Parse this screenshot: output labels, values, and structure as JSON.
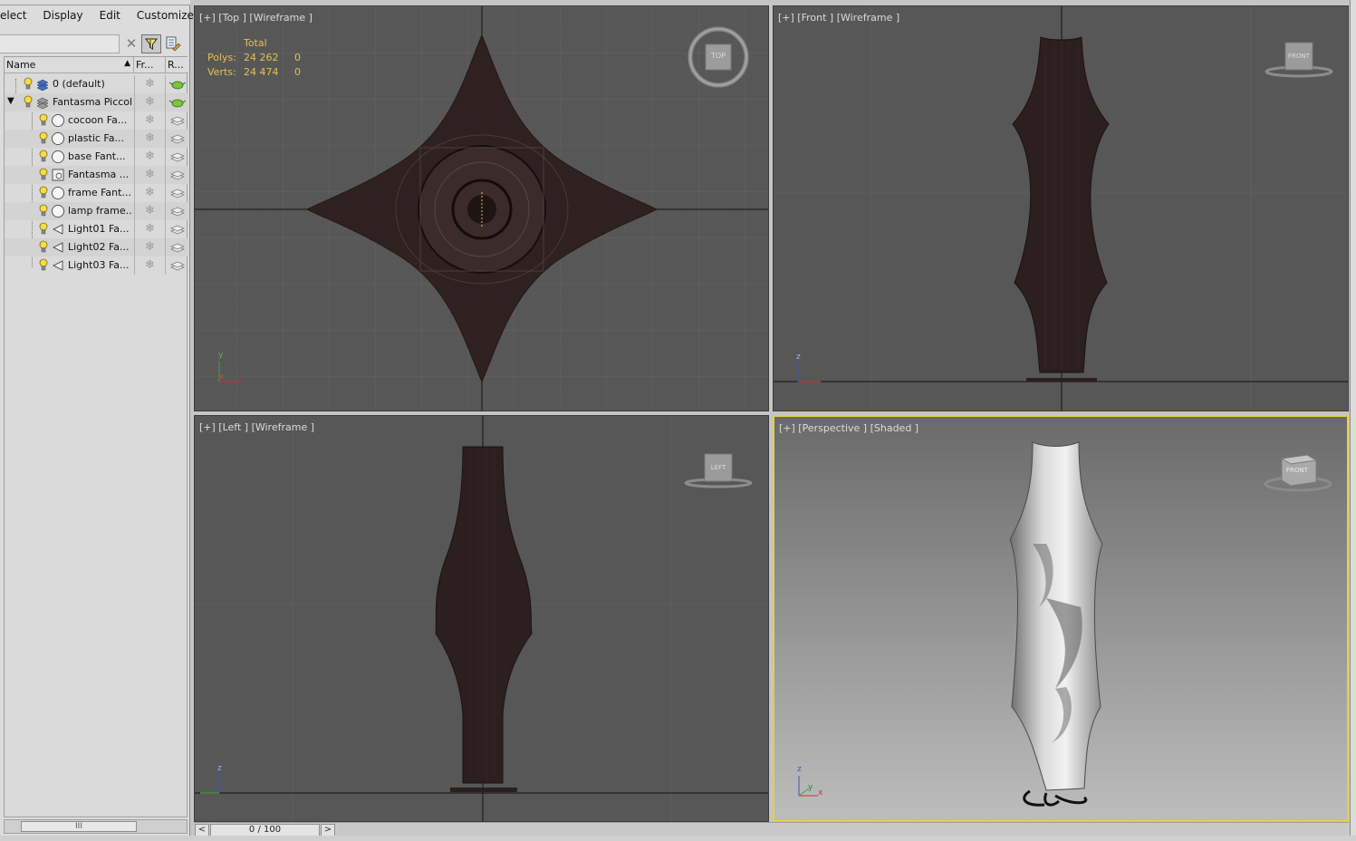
{
  "menu": [
    "elect",
    "Display",
    "Edit",
    "Customize"
  ],
  "scene_explorer": {
    "filter_value": "",
    "columns": {
      "name": "Name",
      "freeze": "Fr...",
      "render": "R..."
    },
    "rows": [
      {
        "label": "0 (default)",
        "type": "layer",
        "level": 0,
        "expander": ""
      },
      {
        "label": "Fantasma Piccolo",
        "type": "layer",
        "level": 0,
        "expander": "▼"
      },
      {
        "label": "cocoon  Fa...",
        "type": "geometry",
        "level": 1,
        "expander": ""
      },
      {
        "label": "plastic  Fa...",
        "type": "geometry",
        "level": 1,
        "expander": ""
      },
      {
        "label": "base  Fant...",
        "type": "geometry",
        "level": 1,
        "expander": ""
      },
      {
        "label": "Fantasma ...",
        "type": "group",
        "level": 1,
        "expander": ""
      },
      {
        "label": "frame  Fant...",
        "type": "geometry",
        "level": 1,
        "expander": ""
      },
      {
        "label": "lamp frame...",
        "type": "geometry",
        "level": 1,
        "expander": ""
      },
      {
        "label": "Light01  Fa...",
        "type": "light",
        "level": 1,
        "expander": ""
      },
      {
        "label": "Light02  Fa...",
        "type": "light",
        "level": 1,
        "expander": ""
      },
      {
        "label": "Light03  Fa...",
        "type": "light",
        "level": 1,
        "expander": ""
      }
    ],
    "scroll_grip": "III"
  },
  "viewports": {
    "top": {
      "label": "[+] [Top ] [Wireframe ]",
      "cube_label": "TOP"
    },
    "front": {
      "label": "[+] [Front ] [Wireframe ]",
      "cube_label": "FRONT"
    },
    "left": {
      "label": "[+] [Left ] [Wireframe ]",
      "cube_label": "LEFT"
    },
    "perspective": {
      "label": "[+] [Perspective ] [Shaded ]",
      "cube_label": "FRONT"
    }
  },
  "stats": {
    "header": "Total",
    "polys_label": "Polys:",
    "polys_total": "24 262",
    "polys_sel": "0",
    "verts_label": "Verts:",
    "verts_total": "24 474",
    "verts_sel": "0"
  },
  "axes": {
    "x": "x",
    "y": "y",
    "z": "z"
  },
  "timeline": {
    "frame": "0 / 100",
    "prev": "<",
    "next": ">"
  },
  "colors": {
    "active_viewport_border": "#e4d23a",
    "stats_text": "#e3c14f",
    "wireframe": "#2a1d1d",
    "viewport_bg": "#575757"
  }
}
